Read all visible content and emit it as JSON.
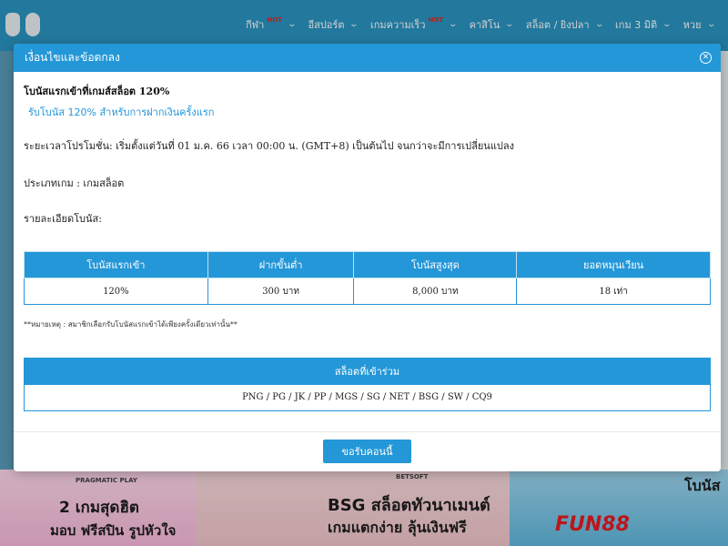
{
  "nav": {
    "items": [
      {
        "label": "กีฬา",
        "hot": "HOT"
      },
      {
        "label": "อีสปอร์ต",
        "hot": ""
      },
      {
        "label": "เกมความเร็ว",
        "hot": "HOT"
      },
      {
        "label": "คาสิโน",
        "hot": ""
      },
      {
        "label": "สล็อต / ยิงปลา",
        "hot": ""
      },
      {
        "label": "เกม 3 มิติ",
        "hot": ""
      },
      {
        "label": "หวย",
        "hot": ""
      }
    ]
  },
  "banners": {
    "b1_brand": "PRAGMATIC PLAY",
    "b1_line1": "2 เกมสุดฮิต",
    "b1_line2": "มอบ ฟรีสปิน รูปหัวใจ",
    "b2_brand": "BETSOFT",
    "b2_line1": "BSG สล็อตทัวนาเมนต์",
    "b2_line2": "เกมแตกง่าย ลุ้นเงินฟรี",
    "b3_line1": "โบนัส",
    "b3_watermark": "FUN88"
  },
  "modal": {
    "title": "เงื่อนไขและข้อตกลง",
    "heading": "โบนัสแรกเข้าที่เกมส์สล็อต 120%",
    "subheading": "รับโบนัส 120% สำหรับการฝากเงินครั้งแรก",
    "period": "ระยะเวลาโปรโมชั่น: เริ่มตั้งแต่วันที่ 01 ม.ค. 66 เวลา 00:00 น. (GMT+8) เป็นต้นไป จนกว่าจะมีการเปลี่ยนแปลง",
    "game_type": "ประเภทเกม : เกมสล็อต",
    "bonus_details": "รายละเอียดโบนัส:",
    "table": {
      "headers": [
        "โบนัสแรกเข้า",
        "ฝากขั้นต่ำ",
        "โบนัสสูงสุด",
        "ยอดหมุนเวียน"
      ],
      "row": [
        "120%",
        "300 บาท",
        "8,000 บาท",
        "18 เท่า"
      ]
    },
    "note": "**หมายเหตุ : สมาชิกเลือกรับโบนัสแรกเข้าได้เพียงครั้งเดียวเท่านั้น**",
    "providers_title": "สล็อตที่เข้าร่วม",
    "providers": "PNG / PG / JK / PP / MGS / SG / NET / BSG / SW / CQ9",
    "accept_label": "ขอรับคอนนี้"
  },
  "colors": {
    "accent": "#2497d8",
    "header_bg": "#2a93c0"
  }
}
